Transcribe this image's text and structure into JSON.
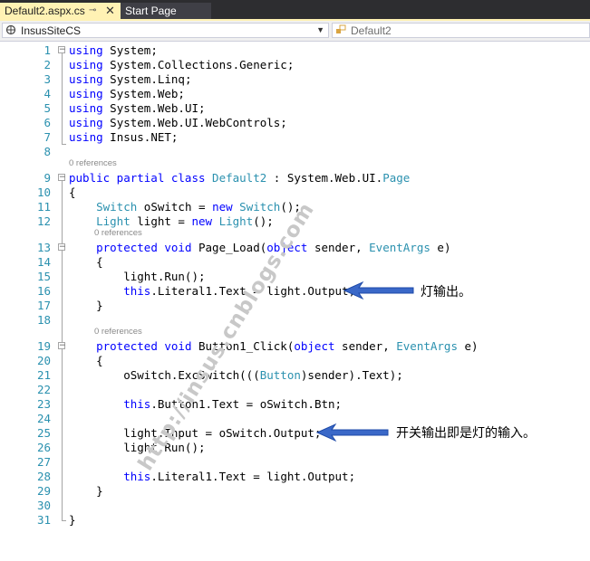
{
  "tabs": {
    "active_label": "Default2.aspx.cs",
    "pin_glyph": "⊸",
    "close_glyph": "✕",
    "inactive_label": "Start Page"
  },
  "navbar": {
    "left_value": "InsusSiteCS",
    "right_value": "Default2"
  },
  "code_lens": {
    "class_refs": "0 references",
    "ctor_refs": "0 references",
    "load_refs": "0 references",
    "click_refs": "0 references"
  },
  "code_lines": [
    {
      "n": "1",
      "segs": [
        [
          "kw",
          "using"
        ],
        [
          "t",
          " System;"
        ]
      ]
    },
    {
      "n": "2",
      "segs": [
        [
          "kw",
          "using"
        ],
        [
          "t",
          " System.Collections.Generic;"
        ]
      ]
    },
    {
      "n": "3",
      "segs": [
        [
          "kw",
          "using"
        ],
        [
          "t",
          " System.Linq;"
        ]
      ]
    },
    {
      "n": "4",
      "segs": [
        [
          "kw",
          "using"
        ],
        [
          "t",
          " System.Web;"
        ]
      ]
    },
    {
      "n": "5",
      "segs": [
        [
          "kw",
          "using"
        ],
        [
          "t",
          " System.Web.UI;"
        ]
      ]
    },
    {
      "n": "6",
      "segs": [
        [
          "kw",
          "using"
        ],
        [
          "t",
          " System.Web.UI.WebControls;"
        ]
      ]
    },
    {
      "n": "7",
      "segs": [
        [
          "kw",
          "using"
        ],
        [
          "t",
          " Insus.NET;"
        ]
      ]
    },
    {
      "n": "8",
      "segs": []
    },
    {
      "n": "9",
      "segs": [
        [
          "kw",
          "public partial class "
        ],
        [
          "ty",
          "Default2"
        ],
        [
          "t",
          " : System.Web.UI."
        ],
        [
          "ty",
          "Page"
        ]
      ]
    },
    {
      "n": "10",
      "segs": [
        [
          "t",
          "{"
        ]
      ]
    },
    {
      "n": "11",
      "segs": [
        [
          "t",
          "    "
        ],
        [
          "ty",
          "Switch"
        ],
        [
          "t",
          " oSwitch = "
        ],
        [
          "kw",
          "new "
        ],
        [
          "ty",
          "Switch"
        ],
        [
          "t",
          "();"
        ]
      ]
    },
    {
      "n": "12",
      "segs": [
        [
          "t",
          "    "
        ],
        [
          "ty",
          "Light"
        ],
        [
          "t",
          " light = "
        ],
        [
          "kw",
          "new "
        ],
        [
          "ty",
          "Light"
        ],
        [
          "t",
          "();"
        ]
      ]
    },
    {
      "n": "13",
      "segs": [
        [
          "t",
          "    "
        ],
        [
          "kw",
          "protected void"
        ],
        [
          "t",
          " Page_Load("
        ],
        [
          "kw",
          "object"
        ],
        [
          "t",
          " sender, "
        ],
        [
          "ty",
          "EventArgs"
        ],
        [
          "t",
          " e)"
        ]
      ]
    },
    {
      "n": "14",
      "segs": [
        [
          "t",
          "    {"
        ]
      ]
    },
    {
      "n": "15",
      "segs": [
        [
          "t",
          "        light.Run();"
        ]
      ]
    },
    {
      "n": "16",
      "segs": [
        [
          "t",
          "        "
        ],
        [
          "kw",
          "this"
        ],
        [
          "t",
          ".Literal1.Text = light.Output;"
        ]
      ]
    },
    {
      "n": "17",
      "segs": [
        [
          "t",
          "    }"
        ]
      ]
    },
    {
      "n": "18",
      "segs": []
    },
    {
      "n": "19",
      "segs": [
        [
          "t",
          "    "
        ],
        [
          "kw",
          "protected void"
        ],
        [
          "t",
          " Button1_Click("
        ],
        [
          "kw",
          "object"
        ],
        [
          "t",
          " sender, "
        ],
        [
          "ty",
          "EventArgs"
        ],
        [
          "t",
          " e)"
        ]
      ]
    },
    {
      "n": "20",
      "segs": [
        [
          "t",
          "    {"
        ]
      ]
    },
    {
      "n": "21",
      "segs": [
        [
          "t",
          "        oSwitch.ExcSwitch((("
        ],
        [
          "ty",
          "Button"
        ],
        [
          "t",
          ")sender).Text);"
        ]
      ]
    },
    {
      "n": "22",
      "segs": []
    },
    {
      "n": "23",
      "segs": [
        [
          "t",
          "        "
        ],
        [
          "kw",
          "this"
        ],
        [
          "t",
          ".Button1.Text = oSwitch.Btn;"
        ]
      ]
    },
    {
      "n": "24",
      "segs": []
    },
    {
      "n": "25",
      "segs": [
        [
          "t",
          "        light.Input = oSwitch.Output;"
        ]
      ]
    },
    {
      "n": "26",
      "segs": [
        [
          "t",
          "        light.Run();"
        ]
      ]
    },
    {
      "n": "27",
      "segs": []
    },
    {
      "n": "28",
      "segs": [
        [
          "t",
          "        "
        ],
        [
          "kw",
          "this"
        ],
        [
          "t",
          ".Literal1.Text = light.Output;"
        ]
      ]
    },
    {
      "n": "29",
      "segs": [
        [
          "t",
          "    }"
        ]
      ]
    },
    {
      "n": "30",
      "segs": []
    },
    {
      "n": "31",
      "segs": [
        [
          "t",
          "}"
        ]
      ]
    }
  ],
  "annotations": {
    "note1": "灯输出。",
    "note2": "开关输出即是灯的输入。",
    "watermark": "http://insus.cnblogs.com"
  },
  "colors": {
    "keyword": "#0000ff",
    "type": "#2b91af",
    "line_number": "#2b91af",
    "arrow": "#3a68c8",
    "active_tab": "#fff2b4",
    "tab_bar": "#2d2d30"
  },
  "icons": {
    "class_combo": "namespace-icon",
    "member_combo": "class-member-icon"
  }
}
